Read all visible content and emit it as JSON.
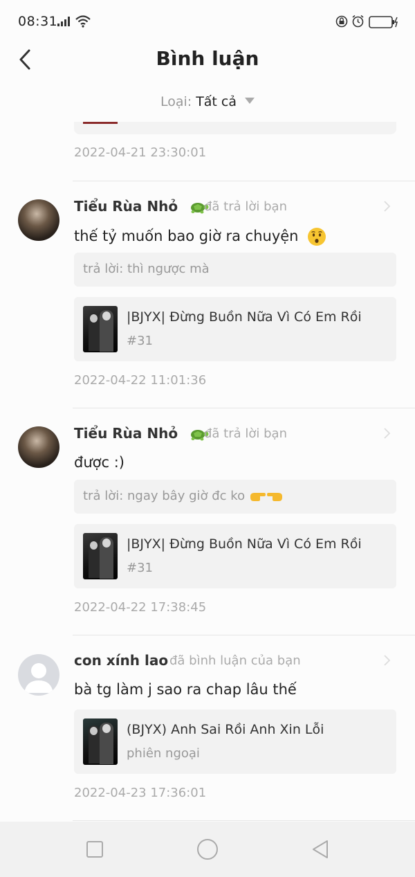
{
  "status_bar": {
    "time": "08:31"
  },
  "header": {
    "title": "Bình luận"
  },
  "filter": {
    "label": "Loại:",
    "value": "Tất cả"
  },
  "top_timestamp": "2022-04-21 23:30:01",
  "notifications": [
    {
      "username": "Tiểu Rùa Nhỏ",
      "action": "đã trả lời bạn",
      "text": "thế tỷ muốn bao giờ ra chuyện",
      "quote": "trả lời: thì ngược mà",
      "story_title": "|BJYX| Đừng Buồn Nữa Vì Có Em Rồi",
      "story_sub": "#31",
      "timestamp": "2022-04-22 11:01:36"
    },
    {
      "username": "Tiểu Rùa Nhỏ",
      "action": "đã trả lời bạn",
      "text": "được :)",
      "quote": "trả lời: ngay bây giờ đc ko",
      "story_title": "|BJYX| Đừng Buồn Nữa Vì Có Em Rồi",
      "story_sub": "#31",
      "timestamp": "2022-04-22 17:38:45"
    },
    {
      "username": "con xính lao",
      "action": "đã bình luận của bạn",
      "text": "bà tg làm j sao ra chap lâu thế",
      "story_title": "(BJYX) Anh Sai Rồi Anh Xin Lỗi",
      "story_sub": "phiên ngoại",
      "timestamp": "2022-04-23 17:36:01"
    }
  ],
  "icons": {
    "back": "chevron-left-icon",
    "turtle": "turtle-icon",
    "kiss": "kissing-face-icon",
    "hands": "pointing-hands-icon",
    "nav_recent": "square-icon",
    "nav_home": "circle-icon",
    "nav_back": "triangle-back-icon"
  }
}
